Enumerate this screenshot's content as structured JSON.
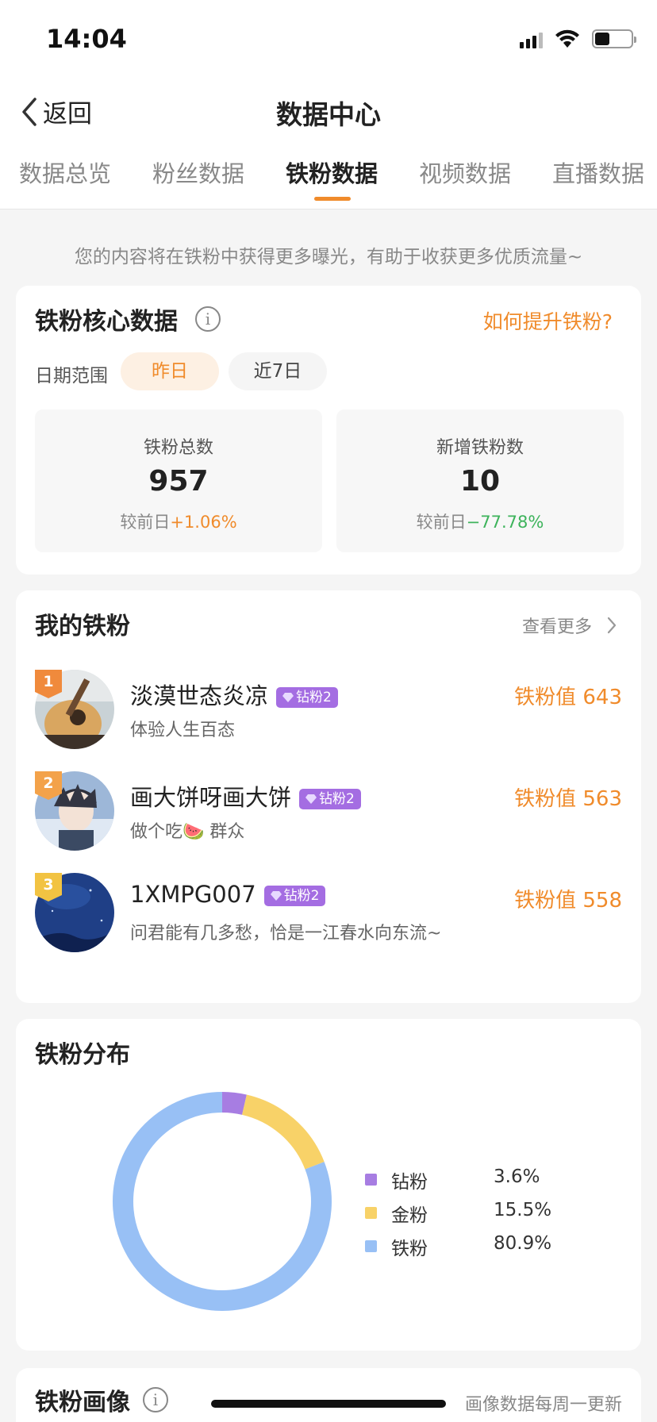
{
  "status_bar": {
    "time": "14:04"
  },
  "nav": {
    "back_label": "返回",
    "title": "数据中心"
  },
  "tabs": [
    {
      "label": "数据总览",
      "active": false
    },
    {
      "label": "粉丝数据",
      "active": false
    },
    {
      "label": "铁粉数据",
      "active": true
    },
    {
      "label": "视频数据",
      "active": false
    },
    {
      "label": "直播数据",
      "active": false
    }
  ],
  "hint": "您的内容将在铁粉中获得更多曝光，有助于收获更多优质流量~",
  "core": {
    "title": "铁粉核心数据",
    "info_glyph": "i",
    "how_link": "如何提升铁粉?",
    "date_label": "日期范围",
    "date_options": [
      "昨日",
      "近7日"
    ],
    "selected_date": "昨日",
    "stats": [
      {
        "label": "铁粉总数",
        "value": "957",
        "compare_label": "较前日",
        "change": "+1.06%",
        "trend": "up"
      },
      {
        "label": "新增铁粉数",
        "value": "10",
        "compare_label": "较前日",
        "change": "−77.78%",
        "trend": "down"
      }
    ]
  },
  "fans": {
    "title": "我的铁粉",
    "more_label": "查看更多",
    "items": [
      {
        "rank": "1",
        "name": "淡漠世态炎凉",
        "badge": "钻粉2",
        "desc": "体验人生百态",
        "score": "铁粉值 643"
      },
      {
        "rank": "2",
        "name": "画大饼呀画大饼",
        "badge": "钻粉2",
        "desc": "做个吃🍉 群众",
        "score": "铁粉值 563"
      },
      {
        "rank": "3",
        "name": "1XMPG007",
        "badge": "钻粉2",
        "desc": "问君能有几多愁，恰是一江春水向东流~",
        "score": "铁粉值 558"
      }
    ]
  },
  "distribution": {
    "title": "铁粉分布",
    "chart_data": {
      "type": "pie",
      "categories": [
        "钻粉",
        "金粉",
        "铁粉"
      ],
      "values": [
        3.6,
        15.5,
        80.9
      ],
      "labels": [
        "3.6%",
        "15.5%",
        "80.9%"
      ],
      "colors": [
        "#a77de2",
        "#f8d268",
        "#98c0f5"
      ],
      "legend": "right"
    }
  },
  "portrait": {
    "title": "铁粉画像",
    "info_glyph": "i",
    "update_note": "画像数据每周一更新"
  }
}
